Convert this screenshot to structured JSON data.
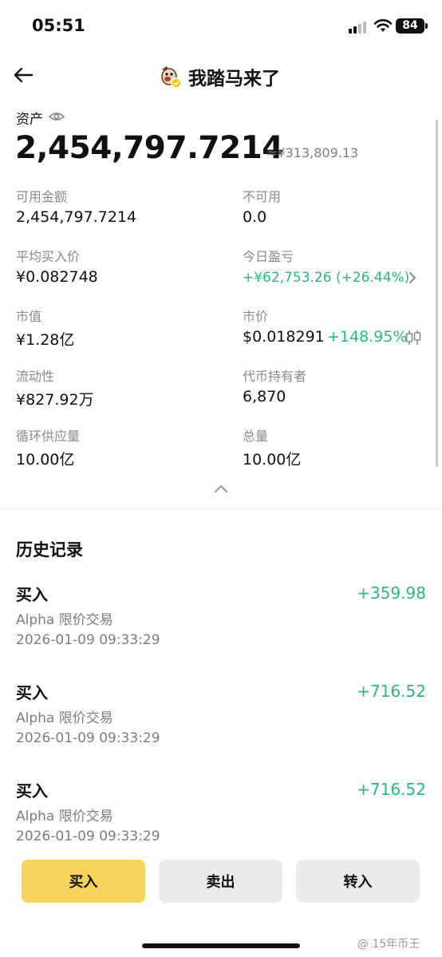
{
  "status_bar": {
    "time": "05:51",
    "battery": "84"
  },
  "header": {
    "title": "我踏马来了"
  },
  "asset": {
    "label": "资产",
    "value": "2,454,797.7214",
    "approx": "≈¥313,809.13"
  },
  "stats": {
    "available_label": "可用金额",
    "available_value": "2,454,797.7214",
    "unavailable_label": "不可用",
    "unavailable_value": "0.0",
    "avg_price_label": "平均买入价",
    "avg_price_value": "¥0.082748",
    "pnl_label": "今日盈亏",
    "pnl_value": "+¥62,753.26 (+26.44%)",
    "mcap_label": "市值",
    "mcap_value": "¥1.28亿",
    "price_label": "市价",
    "price_value": "$0.018291",
    "price_change": "+148.95%",
    "liquidity_label": "流动性",
    "liquidity_value": "¥827.92万",
    "holders_label": "代币持有者",
    "holders_value": "6,870",
    "circ_label": "循环供应量",
    "circ_value": "10.00亿",
    "total_label": "总量",
    "total_value": "10.00亿"
  },
  "history": {
    "title": "历史记录",
    "records": [
      {
        "type": "买入",
        "sub": "Alpha 限价交易",
        "time": "2026-01-09 09:33:29",
        "amount": "+359.98"
      },
      {
        "type": "买入",
        "sub": "Alpha 限价交易",
        "time": "2026-01-09 09:33:29",
        "amount": "+716.52"
      },
      {
        "type": "买入",
        "sub": "Alpha 限价交易",
        "time": "2026-01-09 09:33:29",
        "amount": "+716.52"
      }
    ]
  },
  "actions": {
    "buy": "买入",
    "sell": "卖出",
    "transfer_in": "转入"
  },
  "watermark": "@ 15年币王",
  "colors": {
    "up_green": "#2fb57e",
    "buy_yellow": "#f5d45b"
  }
}
